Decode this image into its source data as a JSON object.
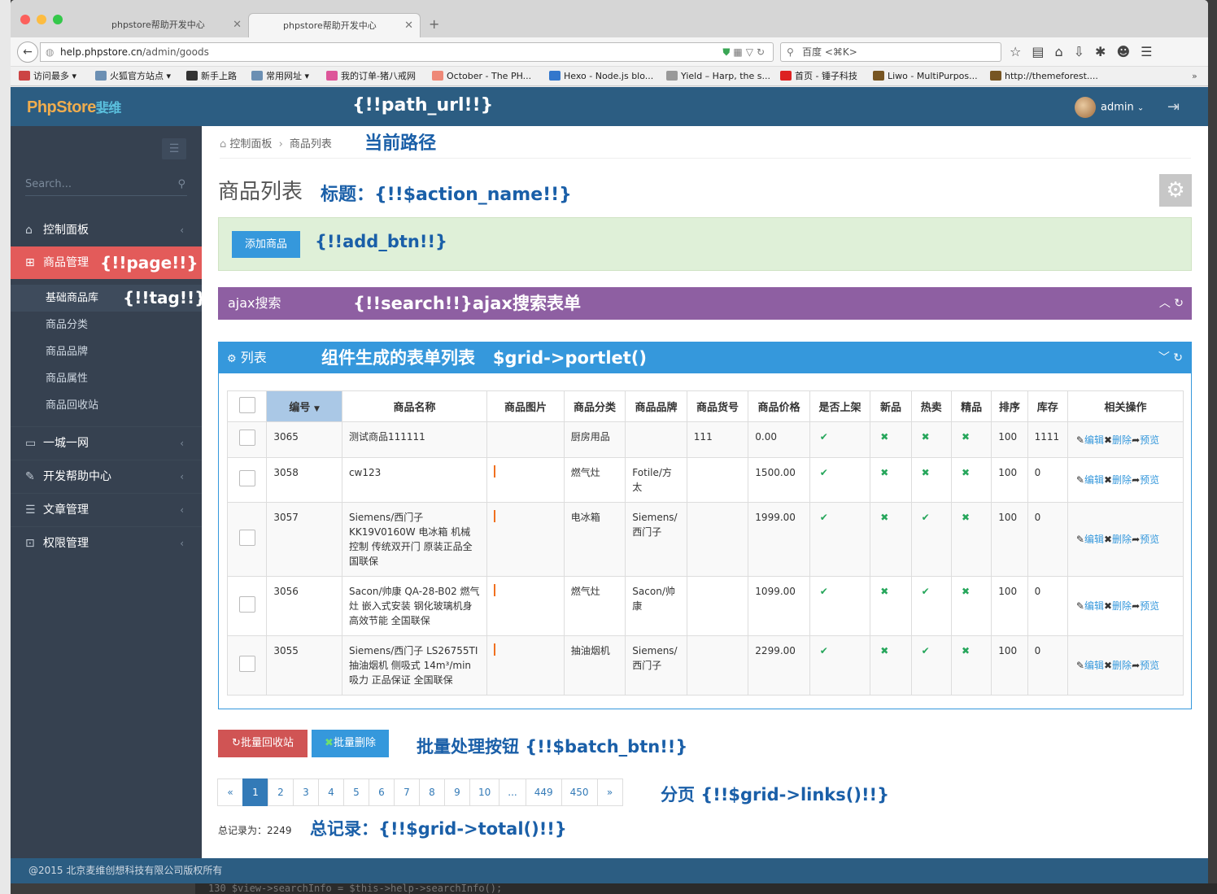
{
  "browser": {
    "tabs": [
      {
        "label": "phpstore帮助开发中心"
      },
      {
        "label": "phpstore帮助开发中心"
      }
    ],
    "url_host": "help.phpstore.cn",
    "url_path": "/admin/goods",
    "search_placeholder": "百度 <⌘K>",
    "bookmarks": [
      {
        "label": "访问最多",
        "color": "#c44"
      },
      {
        "label": "火狐官方站点",
        "color": "#6b8fb3"
      },
      {
        "label": "新手上路",
        "color": "#333"
      },
      {
        "label": "常用网址",
        "color": "#6b8fb3"
      },
      {
        "label": "我的订单-猪八戒网",
        "color": "#d59"
      },
      {
        "label": "October - The PH...",
        "color": "#e87"
      },
      {
        "label": "Hexo - Node.js blo...",
        "color": "#37c"
      },
      {
        "label": "Yield – Harp, the s...",
        "color": "#999"
      },
      {
        "label": "首页 - 锤子科技",
        "color": "#d22"
      },
      {
        "label": "Liwo - MultiPurpos...",
        "color": "#752"
      },
      {
        "label": "http://themeforest....",
        "color": "#752"
      }
    ]
  },
  "header": {
    "logo_main": "PhpStore",
    "logo_sub": "婓维",
    "annotation": "{!!path_url!!}",
    "user": "admin"
  },
  "sidebar": {
    "search_placeholder": "Search...",
    "items": [
      {
        "label": "控制面板",
        "icon": "home-icon"
      },
      {
        "label": "商品管理",
        "icon": "gift-icon",
        "annotation": "{!!page!!}"
      },
      {
        "label": "一城一网",
        "icon": "folder-icon"
      },
      {
        "label": "开发帮助中心",
        "icon": "wrench-icon"
      },
      {
        "label": "文章管理",
        "icon": "list-icon"
      },
      {
        "label": "权限管理",
        "icon": "lock-icon"
      }
    ],
    "subitems": [
      {
        "label": "基础商品库",
        "annotation": "{!!tag!!}"
      },
      {
        "label": "商品分类"
      },
      {
        "label": "商品品牌"
      },
      {
        "label": "商品属性"
      },
      {
        "label": "商品回收站"
      }
    ]
  },
  "breadcrumb": {
    "items": [
      "控制面板",
      "商品列表"
    ],
    "annotation": "当前路径"
  },
  "title": {
    "text": "商品列表",
    "annotation": "标题：{!!$action_name!!}"
  },
  "add": {
    "button": "添加商品",
    "annotation": "{!!add_btn!!}"
  },
  "search": {
    "label": "ajax搜索",
    "annotation": "{!!search!!}ajax搜索表单"
  },
  "portlet": {
    "label": "列表",
    "annotation": "组件生成的表单列表   $grid->portlet()"
  },
  "table": {
    "columns": [
      "编号",
      "商品名称",
      "商品图片",
      "商品分类",
      "商品品牌",
      "商品货号",
      "商品价格",
      "是否上架",
      "新品",
      "热卖",
      "精品",
      "排序",
      "库存",
      "相关操作"
    ],
    "rows": [
      {
        "id": "3065",
        "name": "测试商品111111",
        "category": "厨房用品",
        "brand": "",
        "sn": "111",
        "price": "0.00",
        "onsale": true,
        "new": false,
        "hot": false,
        "best": false,
        "sort": "100",
        "stock": "1111",
        "img": false
      },
      {
        "id": "3058",
        "name": "cw123",
        "category": "燃气灶",
        "brand": "Fotile/方太",
        "sn": "",
        "price": "1500.00",
        "onsale": true,
        "new": false,
        "hot": false,
        "best": false,
        "sort": "100",
        "stock": "0",
        "img": true
      },
      {
        "id": "3057",
        "name": "Siemens/西门子KK19V0160W 电冰箱 机械控制 传统双开门 原装正品全国联保",
        "category": "电冰箱",
        "brand": "Siemens/西门子",
        "sn": "",
        "price": "1999.00",
        "onsale": true,
        "new": false,
        "hot": true,
        "best": false,
        "sort": "100",
        "stock": "0",
        "img": true
      },
      {
        "id": "3056",
        "name": "Sacon/帅康 QA-28-B02 燃气灶 嵌入式安装 钢化玻璃机身 高效节能 全国联保",
        "category": "燃气灶",
        "brand": "Sacon/帅康",
        "sn": "",
        "price": "1099.00",
        "onsale": true,
        "new": false,
        "hot": true,
        "best": false,
        "sort": "100",
        "stock": "0",
        "img": true
      },
      {
        "id": "3055",
        "name": "Siemens/西门子 LS26755TI 抽油烟机 侧吸式 14m³/min 吸力 正品保证 全国联保",
        "category": "抽油烟机",
        "brand": "Siemens/西门子",
        "sn": "",
        "price": "2299.00",
        "onsale": true,
        "new": false,
        "hot": true,
        "best": false,
        "sort": "100",
        "stock": "0",
        "img": true
      }
    ],
    "op_edit": "编辑",
    "op_delete": "删除",
    "op_preview": "预览"
  },
  "batch": {
    "btn1": "批量回收站",
    "btn2": "批量删除",
    "annotation": "批量处理按钮 {!!$batch_btn!!}"
  },
  "pager": {
    "pages": [
      "«",
      "1",
      "2",
      "3",
      "4",
      "5",
      "6",
      "7",
      "8",
      "9",
      "10",
      "...",
      "449",
      "450",
      "»"
    ],
    "active": "1",
    "annotation": "分页 {!!$grid->links()!!}"
  },
  "total": {
    "label": "总记录为：2249",
    "annotation": "总记录：{!!$grid->total()!!}"
  },
  "footer": {
    "text": "@2015 北京麦维创想科技有限公司版权所有"
  },
  "background": {
    "code_line": "130        $view->searchInfo            = $this->help->searchInfo();"
  },
  "colors": {
    "header": "#2c5d82",
    "sidebar": "#364150",
    "active": "#e35b5a",
    "primary": "#3598dc",
    "purple": "#8e5fa2",
    "danger": "#d05454",
    "success_bg": "#dff0d8"
  }
}
